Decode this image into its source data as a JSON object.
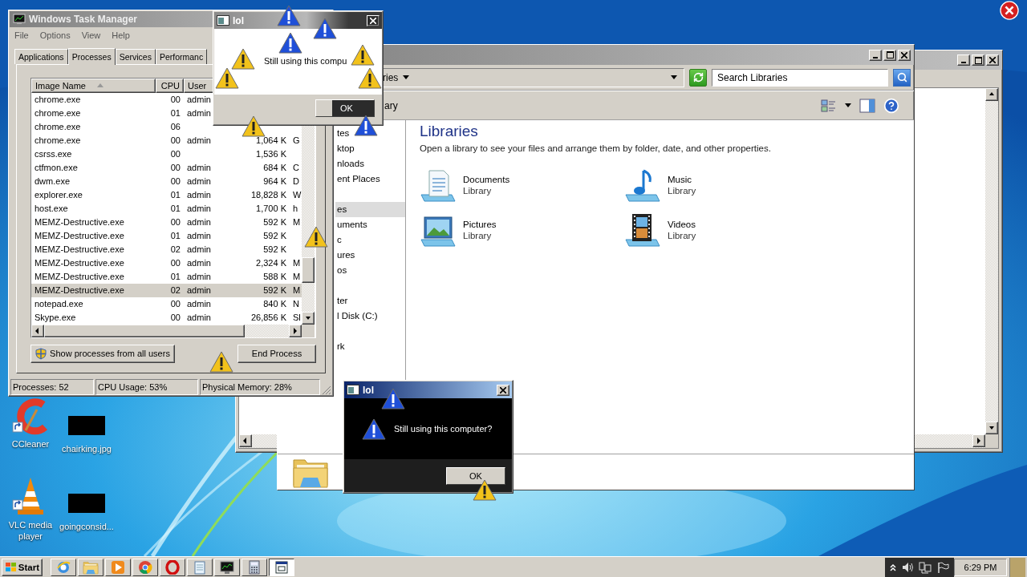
{
  "desktop_icons": [
    {
      "label": "CCleaner",
      "kind": "cleaner"
    },
    {
      "label": "chairking.jpg"
    },
    {
      "label": "VLC media player",
      "kind": "vlc"
    },
    {
      "label": "goingconsid..."
    }
  ],
  "explorer": {
    "address": "ries",
    "search": {
      "placeholder": "Search Libraries"
    },
    "toolbar_text": "ary",
    "nav": [
      {
        "items": [
          {
            "label": "tes",
            "selected": false
          },
          {
            "label": "ktop",
            "selected": false
          },
          {
            "label": "nloads",
            "selected": false
          },
          {
            "label": "ent Places",
            "selected": false
          }
        ]
      },
      {
        "items": [
          {
            "label": "es",
            "selected": true
          },
          {
            "label": "uments",
            "selected": false
          },
          {
            "label": "c",
            "selected": false
          },
          {
            "label": "ures",
            "selected": false
          },
          {
            "label": "os",
            "selected": false
          }
        ]
      },
      {
        "items": [
          {
            "label": "ter",
            "selected": false
          },
          {
            "label": "l Disk (C:)",
            "selected": false
          }
        ]
      },
      {
        "items": [
          {
            "label": "rk",
            "selected": false
          }
        ]
      }
    ],
    "heading": "Libraries",
    "description": "Open a library to see your files and arrange them by folder, date, and other properties.",
    "libraries": [
      {
        "name": "Documents",
        "subtitle": "Library",
        "kind": "documents"
      },
      {
        "name": "Music",
        "subtitle": "Library",
        "kind": "music"
      },
      {
        "name": "Pictures",
        "subtitle": "Library",
        "kind": "pictures"
      },
      {
        "name": "Videos",
        "subtitle": "Library",
        "kind": "videos"
      }
    ]
  },
  "task_manager": {
    "title": "Windows Task Manager",
    "menu": [
      "File",
      "Options",
      "View",
      "Help"
    ],
    "tabs": [
      {
        "label": "Applications",
        "selected": false
      },
      {
        "label": "Processes",
        "selected": true
      },
      {
        "label": "Services",
        "selected": false
      },
      {
        "label": "Performanc",
        "selected": false
      }
    ],
    "columns": [
      "Image Name",
      "CPU",
      "User"
    ],
    "rows": [
      {
        "name": "chrome.exe",
        "cpu": "00",
        "user": "admin",
        "selected": false
      },
      {
        "name": "chrome.exe",
        "cpu": "01",
        "user": "admin",
        "selected": false
      },
      {
        "name": "chrome.exe",
        "cpu": "06",
        "selected": false
      },
      {
        "name": "chrome.exe",
        "cpu": "00",
        "user": "admin",
        "memory": "1,064 K",
        "description": "G",
        "selected": false
      },
      {
        "name": "csrss.exe",
        "cpu": "00",
        "memory": "1,536 K",
        "selected": false
      },
      {
        "name": "ctfmon.exe",
        "cpu": "00",
        "user": "admin",
        "memory": "684 K",
        "description": "C",
        "selected": false
      },
      {
        "name": "dwm.exe",
        "cpu": "00",
        "user": "admin",
        "memory": "964 K",
        "description": "D",
        "selected": false
      },
      {
        "name": "explorer.exe",
        "cpu": "01",
        "user": "admin",
        "memory": "18,828 K",
        "description": "W",
        "selected": false
      },
      {
        "name": "host.exe",
        "cpu": "01",
        "user": "admin",
        "memory": "1,700 K",
        "description": "h",
        "selected": false
      },
      {
        "name": "MEMZ-Destructive.exe",
        "cpu": "00",
        "user": "admin",
        "memory": "592 K",
        "description": "M",
        "selected": false
      },
      {
        "name": "MEMZ-Destructive.exe",
        "cpu": "01",
        "user": "admin",
        "memory": "592 K",
        "selected": false
      },
      {
        "name": "MEMZ-Destructive.exe",
        "cpu": "02",
        "user": "admin",
        "memory": "592 K",
        "selected": false
      },
      {
        "name": "MEMZ-Destructive.exe",
        "cpu": "00",
        "user": "admin",
        "memory": "2,324 K",
        "description": "M",
        "selected": false
      },
      {
        "name": "MEMZ-Destructive.exe",
        "cpu": "01",
        "user": "admin",
        "memory": "588 K",
        "description": "M",
        "selected": false
      },
      {
        "name": "MEMZ-Destructive.exe",
        "cpu": "02",
        "user": "admin",
        "memory": "592 K",
        "description": "M",
        "selected": true
      },
      {
        "name": "notepad.exe",
        "cpu": "00",
        "user": "admin",
        "memory": "840 K",
        "description": "N",
        "selected": false
      },
      {
        "name": "Skype.exe",
        "cpu": "00",
        "user": "admin",
        "memory": "26,856 K",
        "description": "Sl",
        "selected": false
      }
    ],
    "show_all_button": "Show processes from all users",
    "end_button": "End Process",
    "status": [
      "Processes: 52",
      "CPU Usage: 53%",
      "Physical Memory: 28%"
    ]
  },
  "dialogs": [
    {
      "kind": "grey",
      "title": "lol",
      "message": "Still using this compu",
      "button": "OK"
    },
    {
      "kind": "dark",
      "title": "lol",
      "message": "Still using this computer?",
      "button": "OK"
    }
  ],
  "taskbar": {
    "start": "Start",
    "apps": [
      {
        "kind": "ie",
        "pressed": false
      },
      {
        "kind": "explorer",
        "pressed": false
      },
      {
        "kind": "media",
        "pressed": false
      },
      {
        "kind": "chrome",
        "pressed": false
      },
      {
        "kind": "opera",
        "pressed": false
      },
      {
        "kind": "notepad",
        "pressed": false
      },
      {
        "kind": "taskmgr",
        "pressed": false
      },
      {
        "kind": "calculator",
        "pressed": false
      },
      {
        "kind": "window",
        "pressed": true
      }
    ],
    "clock": "6:29 PM"
  }
}
